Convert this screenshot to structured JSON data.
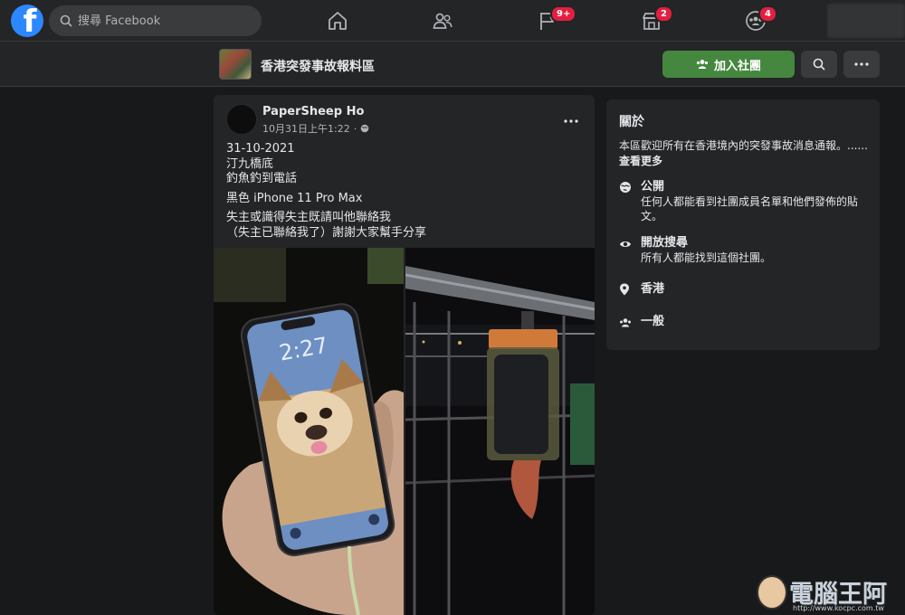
{
  "topbar": {
    "logo_letter": "f",
    "search_placeholder": "搜尋 Facebook",
    "nav": [
      {
        "name": "home",
        "badge": ""
      },
      {
        "name": "friends",
        "badge": ""
      },
      {
        "name": "pages",
        "badge": "9+"
      },
      {
        "name": "marketplace",
        "badge": "2"
      },
      {
        "name": "groups",
        "badge": "4"
      }
    ]
  },
  "group": {
    "title": "香港突發事故報料區",
    "join_label": "加入社團"
  },
  "post": {
    "author": "PaperSheep Ho",
    "timestamp": "10月31日上午1:22",
    "separator": "·",
    "lines": [
      "31-10-2021",
      "汀九橋底",
      "釣魚釣到電話",
      "黑色 iPhone 11 Pro Max",
      "失主或識得失主既請叫他聯絡我",
      "（失主已聯絡我了）謝謝大家幫手分享"
    ],
    "phone_clock": "2:27"
  },
  "about": {
    "title": "關於",
    "description": "本區歡迎所有在香港境內的突發事故消息通報。......",
    "see_more": "查看更多",
    "items": [
      {
        "heading": "公開",
        "sub": "任何人都能看到社團成員名單和他們發佈的貼文。",
        "icon": "globe-icon"
      },
      {
        "heading": "開放搜尋",
        "sub": "所有人都能找到這個社團。",
        "icon": "eye-icon"
      },
      {
        "heading": "香港",
        "sub": "",
        "icon": "location-icon"
      },
      {
        "heading": "一般",
        "sub": "",
        "icon": "group-icon"
      }
    ]
  },
  "watermark": {
    "text": "電腦王阿達",
    "url": "http://www.kocpc.com.tw"
  }
}
